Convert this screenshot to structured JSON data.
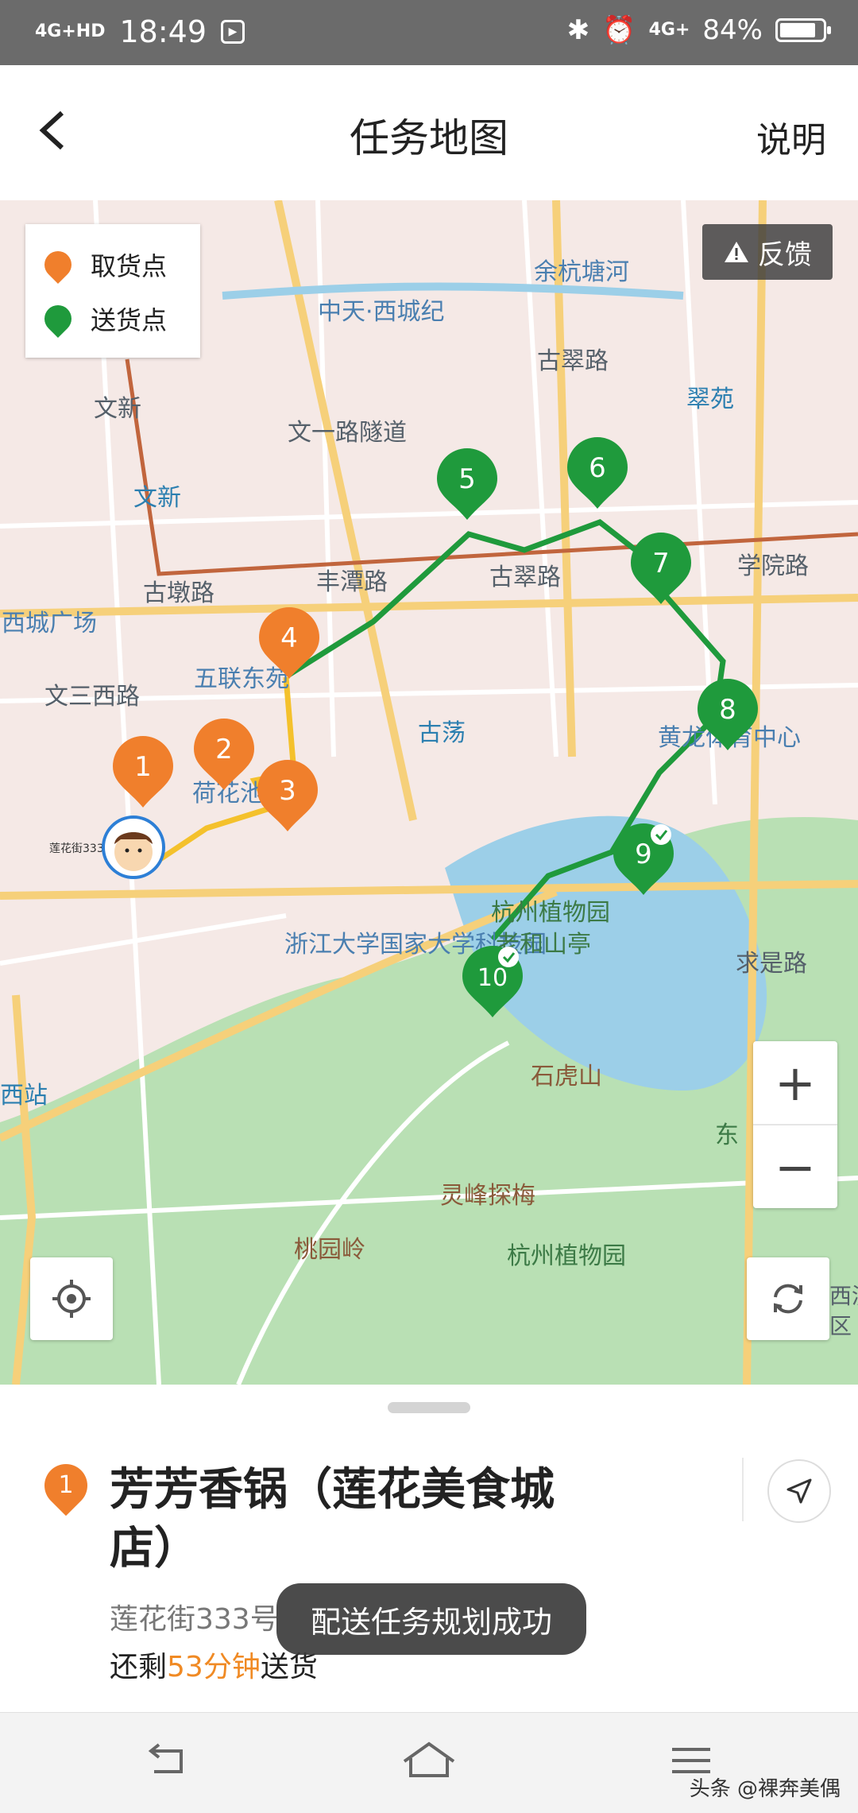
{
  "status_bar": {
    "network": "4G+HD",
    "time": "18:49",
    "network2": "4G+",
    "battery": "84%",
    "battery_fraction": 0.84
  },
  "header": {
    "title": "任务地图",
    "help": "说明"
  },
  "legend": {
    "pickup_label": "取货点",
    "delivery_label": "送货点",
    "pickup_color": "#f07f2c",
    "delivery_color": "#1f9a3c"
  },
  "feedback_label": "反馈",
  "map_labels": {
    "l1": "余杭塘河",
    "l2": "中天·西城纪",
    "l3": "文新",
    "l4": "文一路隧道",
    "l5": "翠苑",
    "l6": "古翠路",
    "l7": "文新",
    "l8": "丰潭路",
    "l9": "古翠路",
    "l10": "学院路",
    "l11": "西城广场",
    "l12": "古墩路",
    "l13": "五联东苑",
    "l14": "文三西路",
    "l15": "古荡",
    "l16": "黄龙体育中心",
    "l17": "荷花池",
    "l18": "浙江大学国家大学科技园",
    "l19": "杭州植物园",
    "l20": "老和山亭",
    "l21": "求是路",
    "l22": "石虎山",
    "l23": "灵峰探梅",
    "l24": "桃园岭",
    "l25": "杭州植物园",
    "l26": "西站",
    "l27": "东",
    "l28": "莲花街333号(一楼)",
    "l29": "西溪",
    "l30": "区"
  },
  "markers": {
    "m1": "1",
    "m2": "2",
    "m3": "3",
    "m4": "4",
    "m5": "5",
    "m6": "6",
    "m7": "7",
    "m8": "8",
    "m9": "9",
    "m10": "10"
  },
  "zoom": {
    "in": "+",
    "out": "−"
  },
  "shop": {
    "index": "1",
    "name": "芳芳香锅（莲花美食城店）",
    "address": "莲花街333号",
    "eta_prefix": "还剩",
    "eta_value": "53分钟",
    "eta_suffix": "送货"
  },
  "toast": "配送任务规划成功",
  "watermark": "头条 @裸奔美偶"
}
